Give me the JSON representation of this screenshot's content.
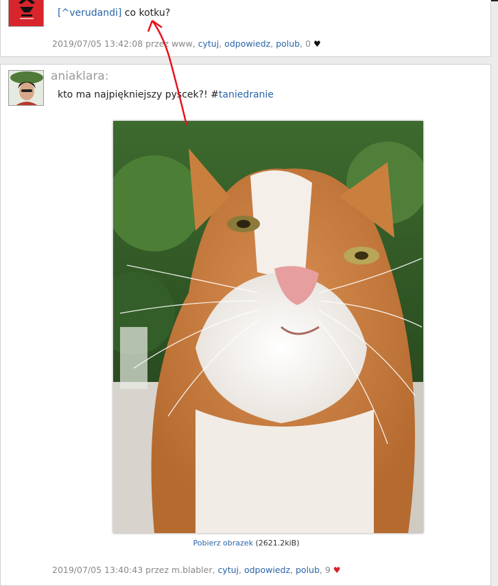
{
  "post1": {
    "quote_prefix": "[",
    "quote_user": "^verudandi",
    "quote_suffix": "]",
    "text": " co kotku?",
    "timestamp": "2019/07/05 13:42:08",
    "by_label": " przez ",
    "author": "www",
    "sep": ", ",
    "actions": {
      "quote": "cytuj",
      "reply": "odpowiedz",
      "like": "polub"
    },
    "likes": "0",
    "heart": "♥"
  },
  "post2": {
    "author": "aniaklara:",
    "text": "kto ma najpiękniejszy pyscek?! #",
    "hashtag": "taniedranie",
    "download_label": "Pobierz obrazek",
    "download_size": " (2621.2kiB)",
    "timestamp": "2019/07/05 13:40:43",
    "by_label": " przez ",
    "by_author": "m.blabler",
    "sep": ", ",
    "actions": {
      "quote": "cytuj",
      "reply": "odpowiedz",
      "like": "polub"
    },
    "likes": "9",
    "heart": "♥"
  },
  "colors": {
    "link": "#2a64a8",
    "meta": "#888888",
    "heart_dark": "#111111",
    "heart_red": "#d9202b",
    "annotation_arrow": "#e8121b"
  },
  "icons": [
    "cat-photo",
    "avatar-red",
    "avatar-user",
    "heart-icon",
    "annotation-arrow"
  ]
}
